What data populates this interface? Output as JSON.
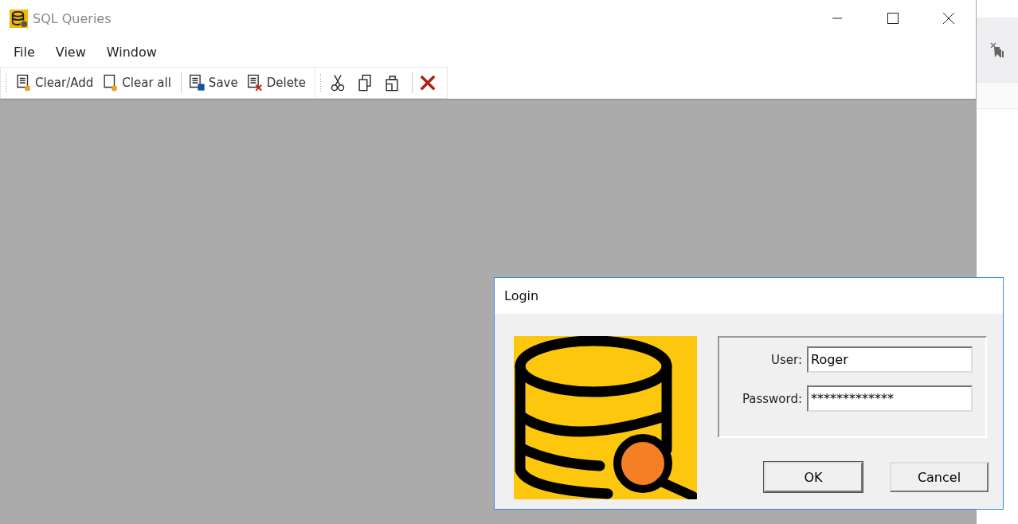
{
  "window": {
    "title": "SQL Queries"
  },
  "menu": [
    "File",
    "View",
    "Window"
  ],
  "toolbar": [
    {
      "kind": "text",
      "label": "Clear/Add"
    },
    {
      "kind": "text",
      "label": "Clear all"
    },
    {
      "kind": "sep"
    },
    {
      "kind": "text",
      "label": "Save"
    },
    {
      "kind": "text",
      "label": "Delete"
    },
    {
      "kind": "grip"
    },
    {
      "kind": "icon"
    },
    {
      "kind": "icon"
    },
    {
      "kind": "icon"
    },
    {
      "kind": "sep"
    },
    {
      "kind": "icon"
    }
  ],
  "dialog": {
    "title": "Login",
    "fields": [
      {
        "label": "User:",
        "value": "Roger"
      },
      {
        "label": "Password:",
        "value": "*************"
      }
    ],
    "buttons": [
      {
        "label": "OK",
        "default": true
      },
      {
        "label": "Cancel",
        "default": false
      }
    ]
  }
}
